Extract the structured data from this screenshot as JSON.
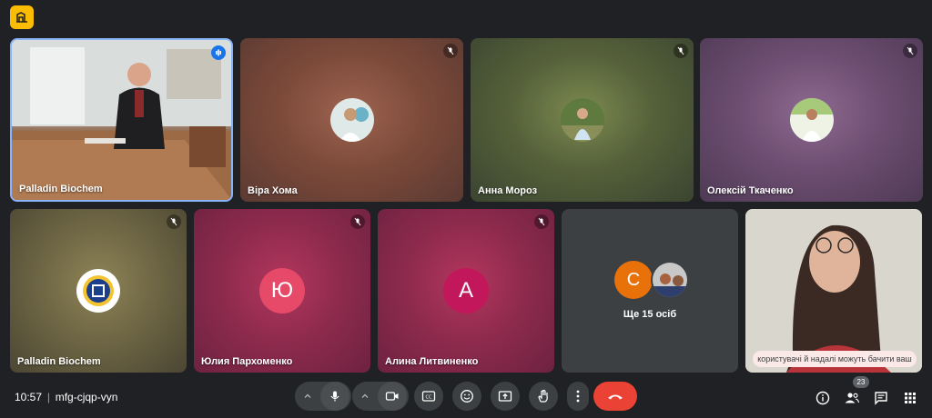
{
  "participants": [
    {
      "name": "Palladin Biochem",
      "muted": false,
      "speaking": true,
      "kind": "video"
    },
    {
      "name": "Віра Хома",
      "muted": true,
      "kind": "photo-avatar"
    },
    {
      "name": "Анна Мороз",
      "muted": true,
      "kind": "photo-avatar"
    },
    {
      "name": "Олексій Ткаченко",
      "muted": true,
      "kind": "photo-avatar"
    },
    {
      "name": "Palladin Biochem",
      "muted": true,
      "kind": "logo-avatar"
    },
    {
      "name": "Юлия Пархоменко",
      "muted": true,
      "initial": "Ю",
      "kind": "letter-avatar"
    },
    {
      "name": "Алина Литвиненко",
      "muted": true,
      "initial": "А",
      "kind": "letter-avatar"
    },
    {
      "initial": "С",
      "more_label": "Ще 15 осіб",
      "kind": "overflow"
    },
    {
      "caption": "користувачі й надалі можуть бачити ваш",
      "kind": "self-video"
    }
  ],
  "bottom_bar": {
    "time": "10:57",
    "meeting_code": "mfg-cjqp-vyn",
    "people_count": "23"
  },
  "icons": [
    "app-logo-icon",
    "speaking-indicator-icon",
    "mic-off-icon",
    "chevron-up-icon",
    "mic-icon",
    "camera-icon",
    "captions-icon",
    "emoji-icon",
    "present-icon",
    "raise-hand-icon",
    "more-vert-icon",
    "call-end-icon",
    "info-icon",
    "people-icon",
    "chat-icon",
    "apps-grid-icon"
  ],
  "colors": {
    "background": "#202124",
    "control_button": "#3c4043",
    "end_call": "#ea4335",
    "speaking_border": "#8ab4f8",
    "avatar_pink": "#c2185b",
    "avatar_orange": "#e8710a",
    "logo_yellow": "#fbbc04"
  }
}
